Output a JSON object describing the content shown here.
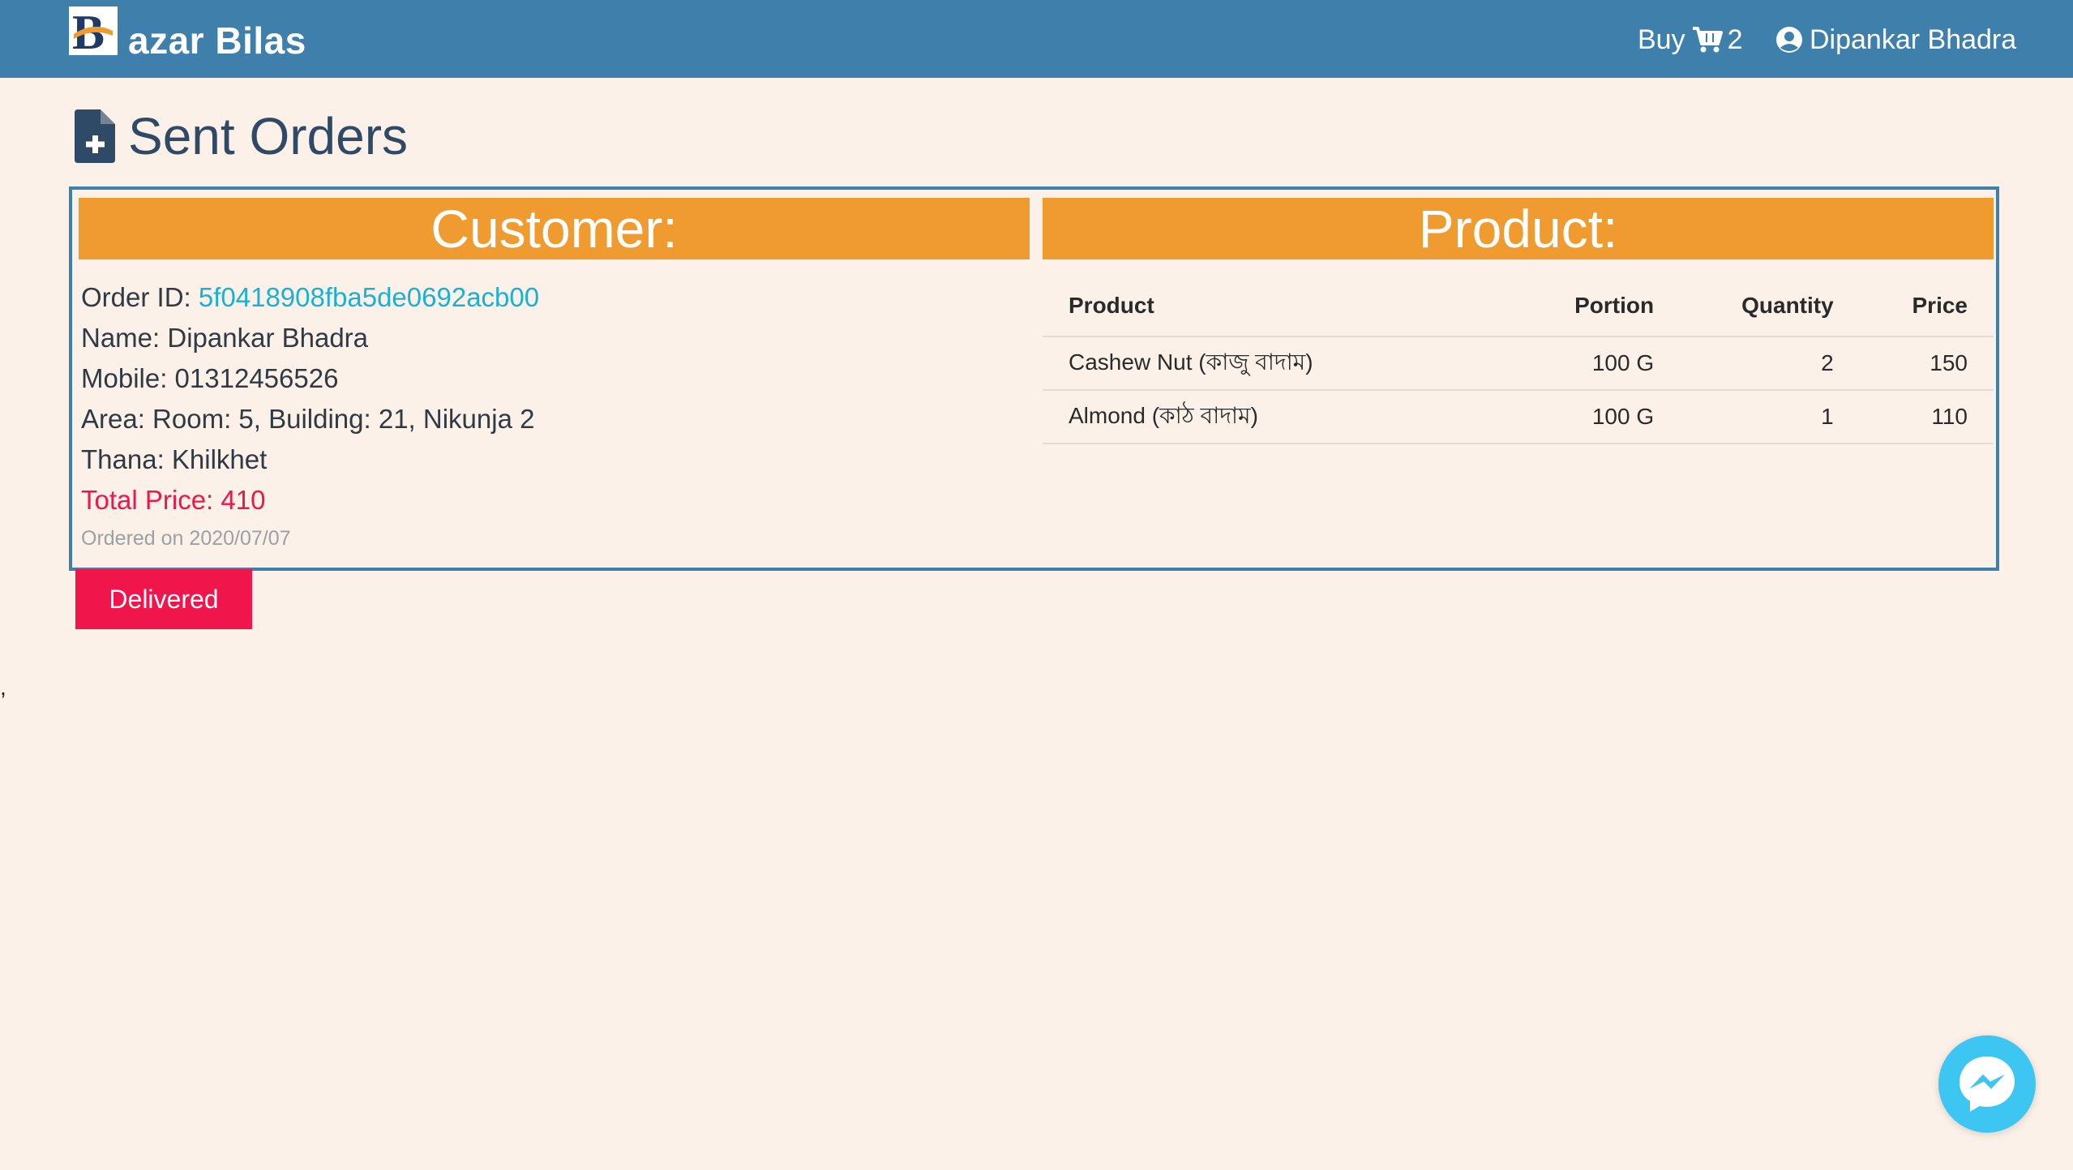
{
  "app": {
    "brand_letter": "B",
    "brand_rest": "azar Bilas"
  },
  "nav": {
    "buy_label": "Buy",
    "cart_count": "2",
    "user_name": "Dipankar Bhadra"
  },
  "page": {
    "title": "Sent Orders"
  },
  "order": {
    "customer_header": "Customer:",
    "product_header": "Product:",
    "order_id_label": "Order ID: ",
    "order_id": "5f0418908fba5de0692acb00",
    "name_line": "Name: Dipankar Bhadra",
    "mobile_line": "Mobile: 01312456526",
    "area_line": "Area: Room: 5, Building: 21, Nikunja 2",
    "thana_line": "Thana: Khilkhet",
    "total_line": "Total Price: 410",
    "ordered_on": "Ordered on 2020/07/07",
    "status_button": "Delivered",
    "table": {
      "columns": [
        "Product",
        "Portion",
        "Quantity",
        "Price"
      ],
      "rows": [
        {
          "product": "Cashew Nut (কাজু বাদাম)",
          "portion": "100 G",
          "quantity": "2",
          "price": "150"
        },
        {
          "product": "Almond (কাঠ বাদাম)",
          "portion": "100 G",
          "quantity": "1",
          "price": "110"
        }
      ]
    }
  },
  "stray_text": ",",
  "colors": {
    "navbar": "#3f7fab",
    "accent_orange": "#f09b2f",
    "status_red": "#f0154b",
    "link_cyan": "#1bb0d4",
    "page_bg": "#fcf1e8"
  },
  "icons": [
    "brand-logo-icon",
    "cart-icon",
    "user-circle-icon",
    "file-plus-icon",
    "messenger-icon"
  ]
}
